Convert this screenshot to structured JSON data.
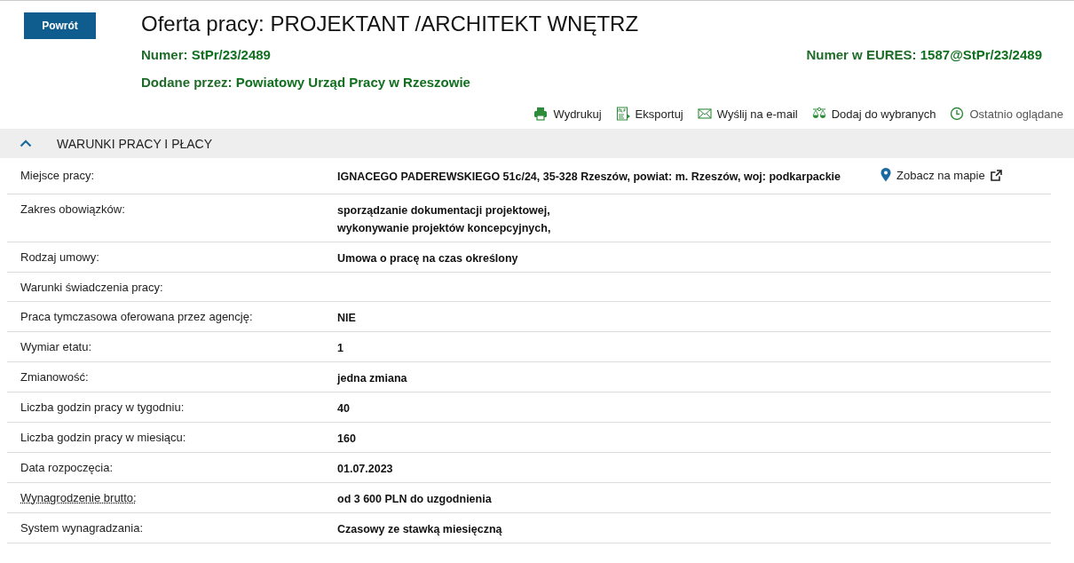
{
  "back_button": "Powrót",
  "title": "Oferta pracy: PROJEKTANT /ARCHITEKT WNĘTRZ",
  "number": {
    "label": "Numer:",
    "value": "StPr/23/2489"
  },
  "eures": {
    "label": "Numer w EURES:",
    "value": "1587@StPr/23/2489"
  },
  "added_by": {
    "label": "Dodane przez:",
    "value": "Powiatowy Urząd Pracy w Rzeszowie"
  },
  "actions": [
    {
      "kind": "print",
      "label": "Wydrukuj"
    },
    {
      "kind": "pdf",
      "label": "Eksportuj"
    },
    {
      "kind": "mail",
      "label": "Wyślij na e-mail"
    },
    {
      "kind": "favorite",
      "label": "Dodaj do wybranych"
    },
    {
      "kind": "recent",
      "label": "Ostatnio oglądane"
    }
  ],
  "section": {
    "title": "WARUNKI PRACY I PŁACY",
    "expanded": true,
    "rows": [
      {
        "label": "Miejsce pracy:",
        "underlined": false,
        "values": [
          "IGNACEGO PADEREWSKIEGO 51c/24, 35-328 Rzeszów, powiat: m. Rzeszów, woj: podkarpackie"
        ],
        "map_link": "Zobacz na mapie"
      },
      {
        "label": "Zakres obowiązków:",
        "underlined": false,
        "values": [
          "sporządzanie dokumentacji projektowej,",
          "wykonywanie projektów koncepcyjnych,"
        ]
      },
      {
        "label": "Rodzaj umowy:",
        "underlined": false,
        "values": [
          "Umowa o pracę na czas określony"
        ]
      },
      {
        "label": "Warunki świadczenia pracy:",
        "underlined": false,
        "values": []
      },
      {
        "label": "Praca tymczasowa oferowana przez agencję:",
        "underlined": false,
        "values": [
          "NIE"
        ]
      },
      {
        "label": "Wymiar etatu:",
        "underlined": false,
        "values": [
          "1"
        ]
      },
      {
        "label": "Zmianowość:",
        "underlined": false,
        "values": [
          "jedna zmiana"
        ]
      },
      {
        "label": "Liczba godzin pracy w tygodniu:",
        "underlined": false,
        "values": [
          "40"
        ]
      },
      {
        "label": "Liczba godzin pracy w miesiącu:",
        "underlined": false,
        "values": [
          "160"
        ]
      },
      {
        "label": "Data rozpoczęcia:",
        "underlined": false,
        "values": [
          "01.07.2023"
        ]
      },
      {
        "label": "Wynagrodzenie brutto:",
        "underlined": true,
        "values": [
          "od 3 600 PLN do uzgodnienia"
        ]
      },
      {
        "label": "System wynagradzania:",
        "underlined": false,
        "values": [
          "Czasowy ze stawką miesięczną"
        ]
      }
    ]
  }
}
